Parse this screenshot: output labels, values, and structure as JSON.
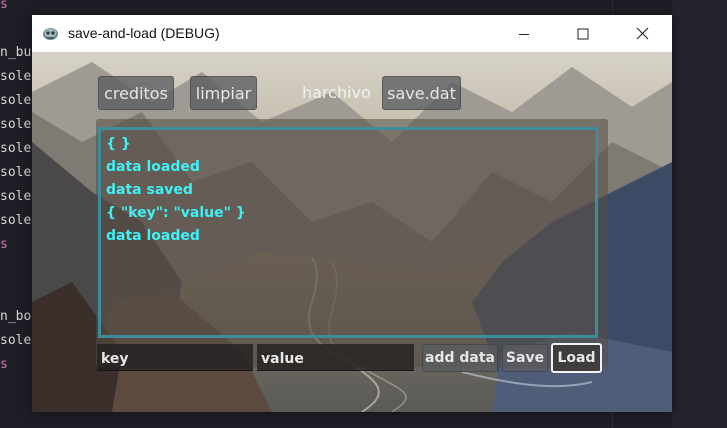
{
  "editor": {
    "lines": [
      {
        "text": "s",
        "style": "pink"
      },
      {
        "text": "",
        "style": ""
      },
      {
        "text": "n_bu",
        "style": ""
      },
      {
        "text": "sole",
        "style": ""
      },
      {
        "text": "sole",
        "style": ""
      },
      {
        "text": "sole",
        "style": ""
      },
      {
        "text": "sole",
        "style": ""
      },
      {
        "text": "sole",
        "style": ""
      },
      {
        "text": "sole",
        "style": ""
      },
      {
        "text": "sole",
        "style": ""
      },
      {
        "text": "s",
        "style": "pink"
      },
      {
        "text": "",
        "style": ""
      },
      {
        "text": "",
        "style": ""
      },
      {
        "text": "n_bo",
        "style": ""
      },
      {
        "text": "sole",
        "style": ""
      },
      {
        "text": "s",
        "style": "pink"
      }
    ]
  },
  "window": {
    "title": "save-and-load (DEBUG)",
    "icon": "godot-robot-icon"
  },
  "toolbar": {
    "creditos": "creditos",
    "limpiar": "limpiar",
    "harchivo_label": "harchivo",
    "file_name": "save.dat"
  },
  "log": {
    "lines": [
      "{ }",
      "data loaded",
      "data saved",
      "{ \"key\": \"value\" }",
      "data loaded"
    ],
    "text_color": "#3ff0f4",
    "border_color": "#3a8e9c"
  },
  "form": {
    "key_value": "key",
    "value_value": "value",
    "add_data": "add data",
    "save": "Save",
    "load": "Load"
  }
}
